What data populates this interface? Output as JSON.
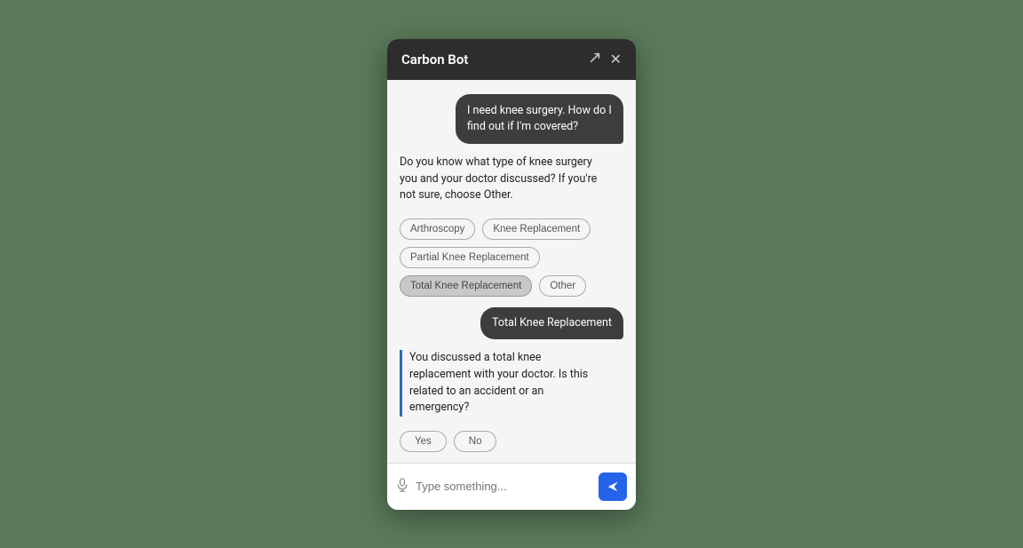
{
  "header": {
    "title": "Carbon Bot",
    "external_icon_label": "external-link",
    "close_icon_label": "close"
  },
  "messages": [
    {
      "id": "msg1",
      "type": "user",
      "text": "I need knee surgery. How do I find out if I'm covered?"
    },
    {
      "id": "msg2",
      "type": "bot",
      "text": "Do you know what type of knee surgery you and your doctor discussed? If you're not sure, choose Other."
    },
    {
      "id": "msg3",
      "type": "chips",
      "chips": [
        {
          "label": "Arthroscopy",
          "selected": false
        },
        {
          "label": "Knee Replacement",
          "selected": false
        },
        {
          "label": "Partial Knee Replacement",
          "selected": false
        },
        {
          "label": "Total Knee Replacement",
          "selected": true
        },
        {
          "label": "Other",
          "selected": false
        }
      ]
    },
    {
      "id": "msg4",
      "type": "user",
      "text": "Total Knee Replacement"
    },
    {
      "id": "msg5",
      "type": "bot_highlighted",
      "text": "You discussed a total knee replacement with your doctor. Is this related to an accident or an emergency?"
    },
    {
      "id": "msg6",
      "type": "yesno",
      "chips": [
        {
          "label": "Yes"
        },
        {
          "label": "No"
        }
      ]
    }
  ],
  "input": {
    "placeholder": "Type something...",
    "send_label": "Send"
  }
}
